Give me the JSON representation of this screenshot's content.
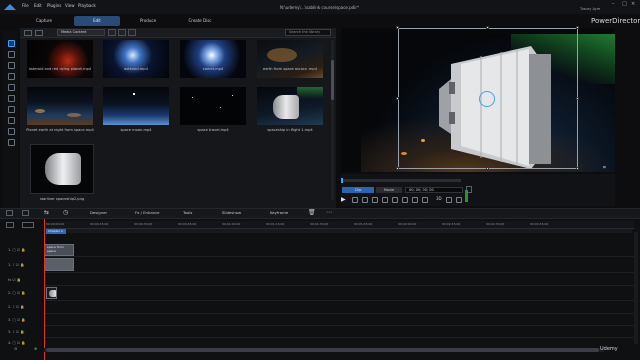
{
  "titlebar": {
    "menu": [
      "File",
      "Edit",
      "Plugins",
      "View",
      "Playback"
    ],
    "project_path": "N:\\udemy\\...\\sablink course\\space.pdir*",
    "user_name": "Tracey Ayre",
    "brand": "PowerDirector"
  },
  "mode_tabs": [
    "Capture",
    "Edit",
    "Produce",
    "Create Disc"
  ],
  "library": {
    "media_select": "Media Content",
    "search_placeholder": "Search the library",
    "items": [
      {
        "label": "asteroid and red dying planet.mp4",
        "scene": "planet-red"
      },
      {
        "label": "asteroid.mp4",
        "scene": "asteroid-blue"
      },
      {
        "label": "comet.mp4",
        "scene": "comet"
      },
      {
        "label": "earth from space aurora .mp4",
        "scene": "aurora"
      },
      {
        "label": "Planet earth at night from space.mp4",
        "scene": "earth-night"
      },
      {
        "label": "space moon.mp4",
        "scene": "moon"
      },
      {
        "label": "space travel.mp4",
        "scene": "stars"
      },
      {
        "label": "spaceship in flight 1.mp4",
        "scene": "ship"
      },
      {
        "label": "starliner spaceship2.png",
        "scene": "ship-still"
      }
    ]
  },
  "preview": {
    "clip_label": "Clip",
    "movie_label": "Movie",
    "timecode": "00; 00; 00; 00",
    "mode_3d": "3D"
  },
  "timeline_toolbar": {
    "designer": "Designer",
    "fx": "Fx / Enhance",
    "tools": "Tools",
    "slideshow": "Slideshow",
    "keyframe": "Keyframe"
  },
  "timeline": {
    "ruler": [
      "00;00;00;00",
      "00;00;15;00",
      "00;00;30;00",
      "00;00;45;00",
      "00;01;00;00",
      "00;01;15;00",
      "00;01;30;00",
      "00;01;45;00",
      "00;02;00;00",
      "00;02;15;00",
      "00;02;30;00",
      "00;02;45;00"
    ],
    "chapter": "Chapter 1",
    "clip_label": "space from space"
  },
  "watermark": "Udemy",
  "colors": {
    "accent": "#2a66b0",
    "playhead": "#e03030",
    "selection_marker": "#3aa3ff"
  }
}
